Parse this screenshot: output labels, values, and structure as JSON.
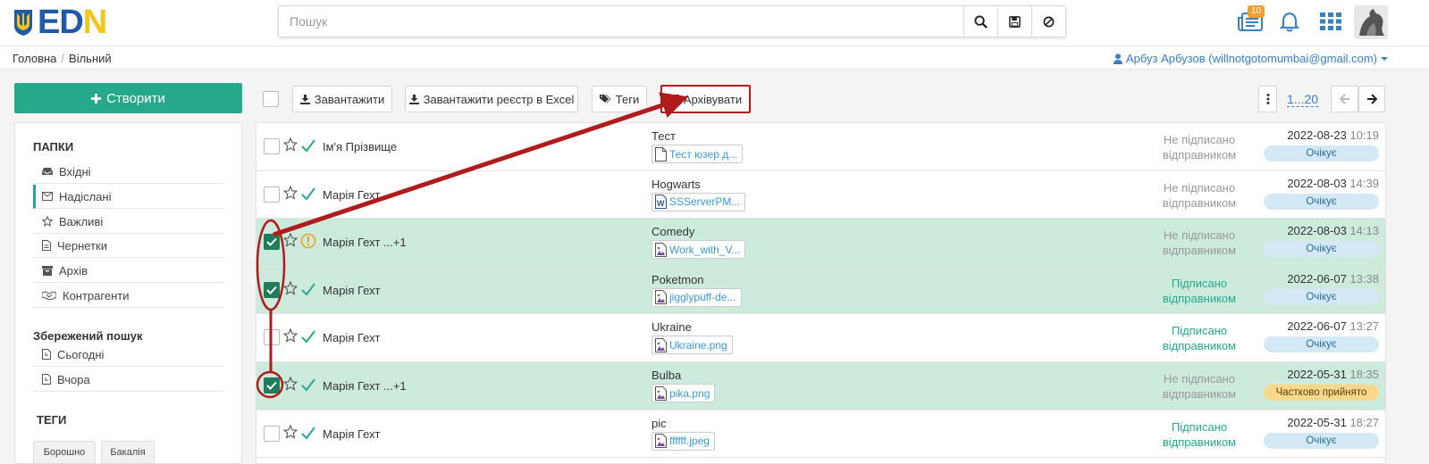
{
  "brand": {
    "logo_text_blue": "ED",
    "logo_text_yellow": "N",
    "logo_glyph": "I",
    "shield": "ukraine-trident-icon"
  },
  "search": {
    "placeholder": "Пошук",
    "value": ""
  },
  "header": {
    "badge_count": "10"
  },
  "breadcrumb": {
    "home": "Головна",
    "current": "Вільний"
  },
  "user": {
    "label": "Арбуз Арбузов (willnotgotomumbai@gmail.com)"
  },
  "sidebar": {
    "create_label": "Створити",
    "folders_title": "ПАПКИ",
    "folders": [
      {
        "label": "Вхідні",
        "icon": "inbox-icon"
      },
      {
        "label": "Надіслані",
        "icon": "envelope-icon"
      },
      {
        "label": "Важливі",
        "icon": "star-icon"
      },
      {
        "label": "Чернетки",
        "icon": "draft-icon"
      },
      {
        "label": "Архів",
        "icon": "archive-icon"
      },
      {
        "label": "Контрагенти",
        "icon": "handshake-icon"
      }
    ],
    "saved_title": "Збережений пошук",
    "saved": [
      {
        "label": "Сьогодні",
        "icon": "file-icon"
      },
      {
        "label": "Вчора",
        "icon": "file-icon"
      }
    ],
    "tags_title": "ТЕГИ",
    "tags": [
      "Борошно",
      "Бакалія"
    ]
  },
  "toolbar": {
    "download": "Завантажити",
    "download_excel": "Завантажити реєстр в Excel",
    "tags": "Теги",
    "archive": "Архівувати",
    "pager": "1...20"
  },
  "rows": [
    {
      "sender": "Ім'я Прізвище",
      "subject": "Тест",
      "file": "Тест юзер д...",
      "file_icon": "doc-icon",
      "sign": [
        "Не підписано",
        "відправником"
      ],
      "signed": false,
      "date": "2022-08-23",
      "time": "10:19",
      "status": "Очікує",
      "selected": false,
      "mark": "check"
    },
    {
      "sender": "Марія Гехт",
      "subject": "Hogwarts",
      "file": "SSServerPM...",
      "file_icon": "word-icon",
      "sign": [
        "Не підписано",
        "відправником"
      ],
      "signed": false,
      "date": "2022-08-03",
      "time": "14:39",
      "status": "Очікує",
      "selected": false,
      "mark": "check"
    },
    {
      "sender": "Марія Гехт ...+1",
      "subject": "Comedy",
      "file": "Work_with_V...",
      "file_icon": "image-icon",
      "sign": [
        "Не підписано",
        "відправником"
      ],
      "signed": false,
      "date": "2022-08-03",
      "time": "14:13",
      "status": "Очікує",
      "selected": true,
      "mark": "warning"
    },
    {
      "sender": "Марія Гехт",
      "subject": "Poketmon",
      "file": "jigglypuff-de...",
      "file_icon": "image-icon",
      "sign": [
        "Підписано",
        "відправником"
      ],
      "signed": true,
      "date": "2022-06-07",
      "time": "13:38",
      "status": "Очікує",
      "selected": true,
      "mark": "check"
    },
    {
      "sender": "Марія Гехт",
      "subject": "Ukraine",
      "file": "Ukraine.png",
      "file_icon": "image-icon",
      "sign": [
        "Підписано",
        "відправником"
      ],
      "signed": true,
      "date": "2022-06-07",
      "time": "13:27",
      "status": "Очікує",
      "selected": false,
      "mark": "check"
    },
    {
      "sender": "Марія Гехт ...+1",
      "subject": "Bulba",
      "file": "pika.png",
      "file_icon": "image-icon",
      "sign": [
        "Не підписано",
        "відправником"
      ],
      "signed": false,
      "date": "2022-05-31",
      "time": "18:35",
      "status": "Частково прийнято",
      "selected": true,
      "mark": "check"
    },
    {
      "sender": "Марія Гехт",
      "subject": "pic",
      "file": "ffffff.jpeg",
      "file_icon": "image-icon",
      "sign": [
        "Підписано",
        "відправником"
      ],
      "signed": true,
      "date": "2022-05-31",
      "time": "18:27",
      "status": "Очікує",
      "selected": false,
      "mark": "check"
    }
  ],
  "colors": {
    "accent": "#26a98a",
    "selected_row": "#cdebdd",
    "annotation": "#b01c1c",
    "link": "#3a7fc2"
  }
}
